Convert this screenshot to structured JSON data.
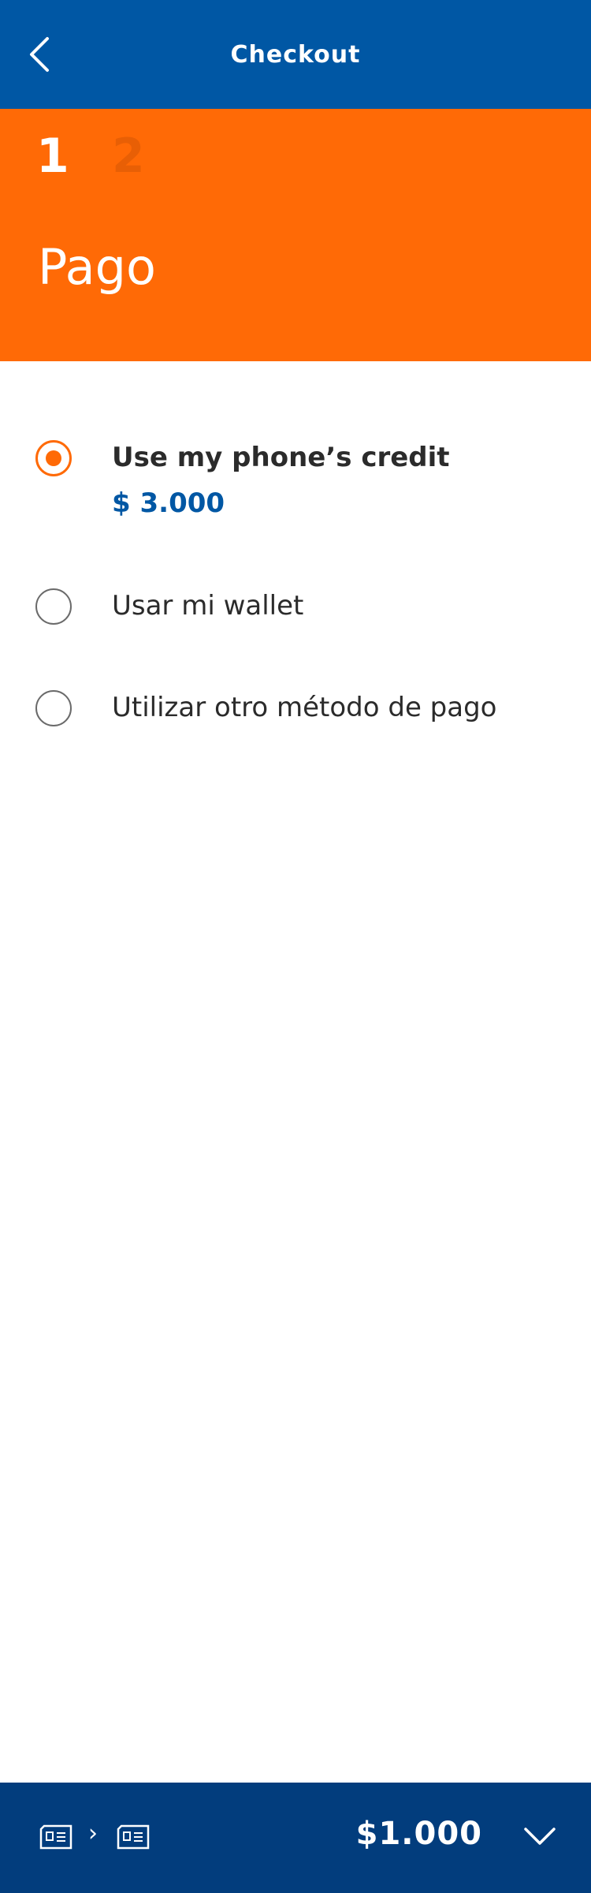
{
  "header": {
    "title": "Checkout",
    "back_icon": "chevron-left-icon"
  },
  "steps": {
    "current": "1",
    "next": "2",
    "title": "Pago"
  },
  "payment_options": [
    {
      "label": "Use my phone’s credit",
      "amount": "$ 3.000",
      "selected": true
    },
    {
      "label": "Usar mi wallet",
      "selected": false
    },
    {
      "label": "Utilizar otro método de pago",
      "selected": false
    }
  ],
  "footer": {
    "amount": "$1.000",
    "from_icon": "card-icon",
    "to_icon": "card-icon",
    "toggle_icon": "chevron-down-icon"
  },
  "colors": {
    "header_blue": "#0057a4",
    "accent_orange": "#ff6a06",
    "footer_navy": "#023d7d"
  }
}
